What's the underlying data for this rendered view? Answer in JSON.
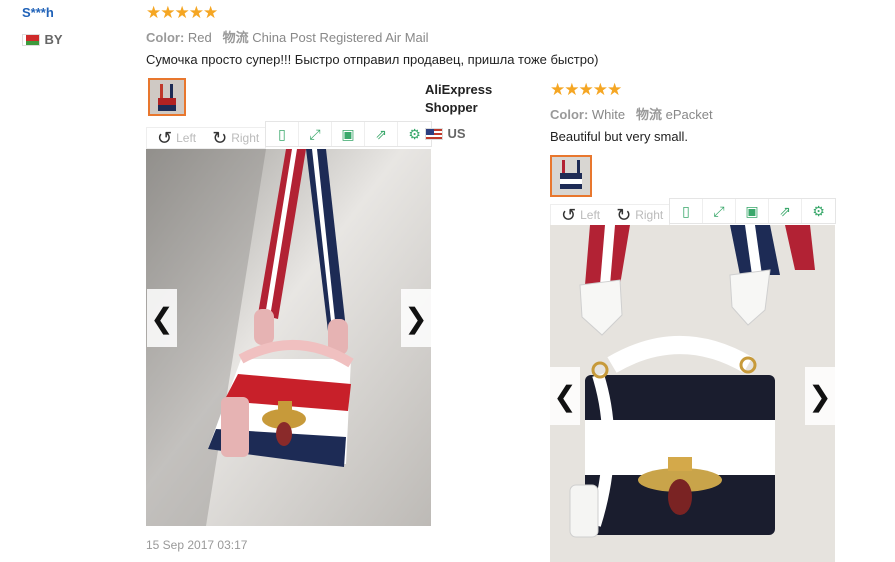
{
  "review1": {
    "user": "S***h",
    "country": "BY",
    "rating": "★★★★★",
    "color_label": "Color:",
    "color_value": "Red",
    "shipping_label": "物流",
    "shipping_value": "China Post Registered Air Mail",
    "text": "Сумочка просто супер!!! Быстро отправил продавец, пришла тоже быстро)",
    "rotate_left": "Left",
    "rotate_right": "Right",
    "date": "15 Sep 2017 03:17"
  },
  "review2": {
    "user_line1": "AliExpress",
    "user_line2": "Shopper",
    "country": "US",
    "rating": "★★★★★",
    "color_label": "Color:",
    "color_value": "White",
    "shipping_label": "物流",
    "shipping_value": "ePacket",
    "text": "Beautiful but very small.",
    "rotate_left": "Left",
    "rotate_right": "Right"
  },
  "icons": {
    "rotate_left": "↺",
    "rotate_right": "↻",
    "prev": "❮",
    "next": "❯",
    "toolbar": [
      "▯",
      "⤢",
      "▣",
      "⇗",
      "⚙"
    ]
  },
  "colors": {
    "accent_green": "#3aa86b",
    "thumb_border": "#e8772e",
    "star": "#f5a623",
    "user_link": "#2062b8"
  }
}
